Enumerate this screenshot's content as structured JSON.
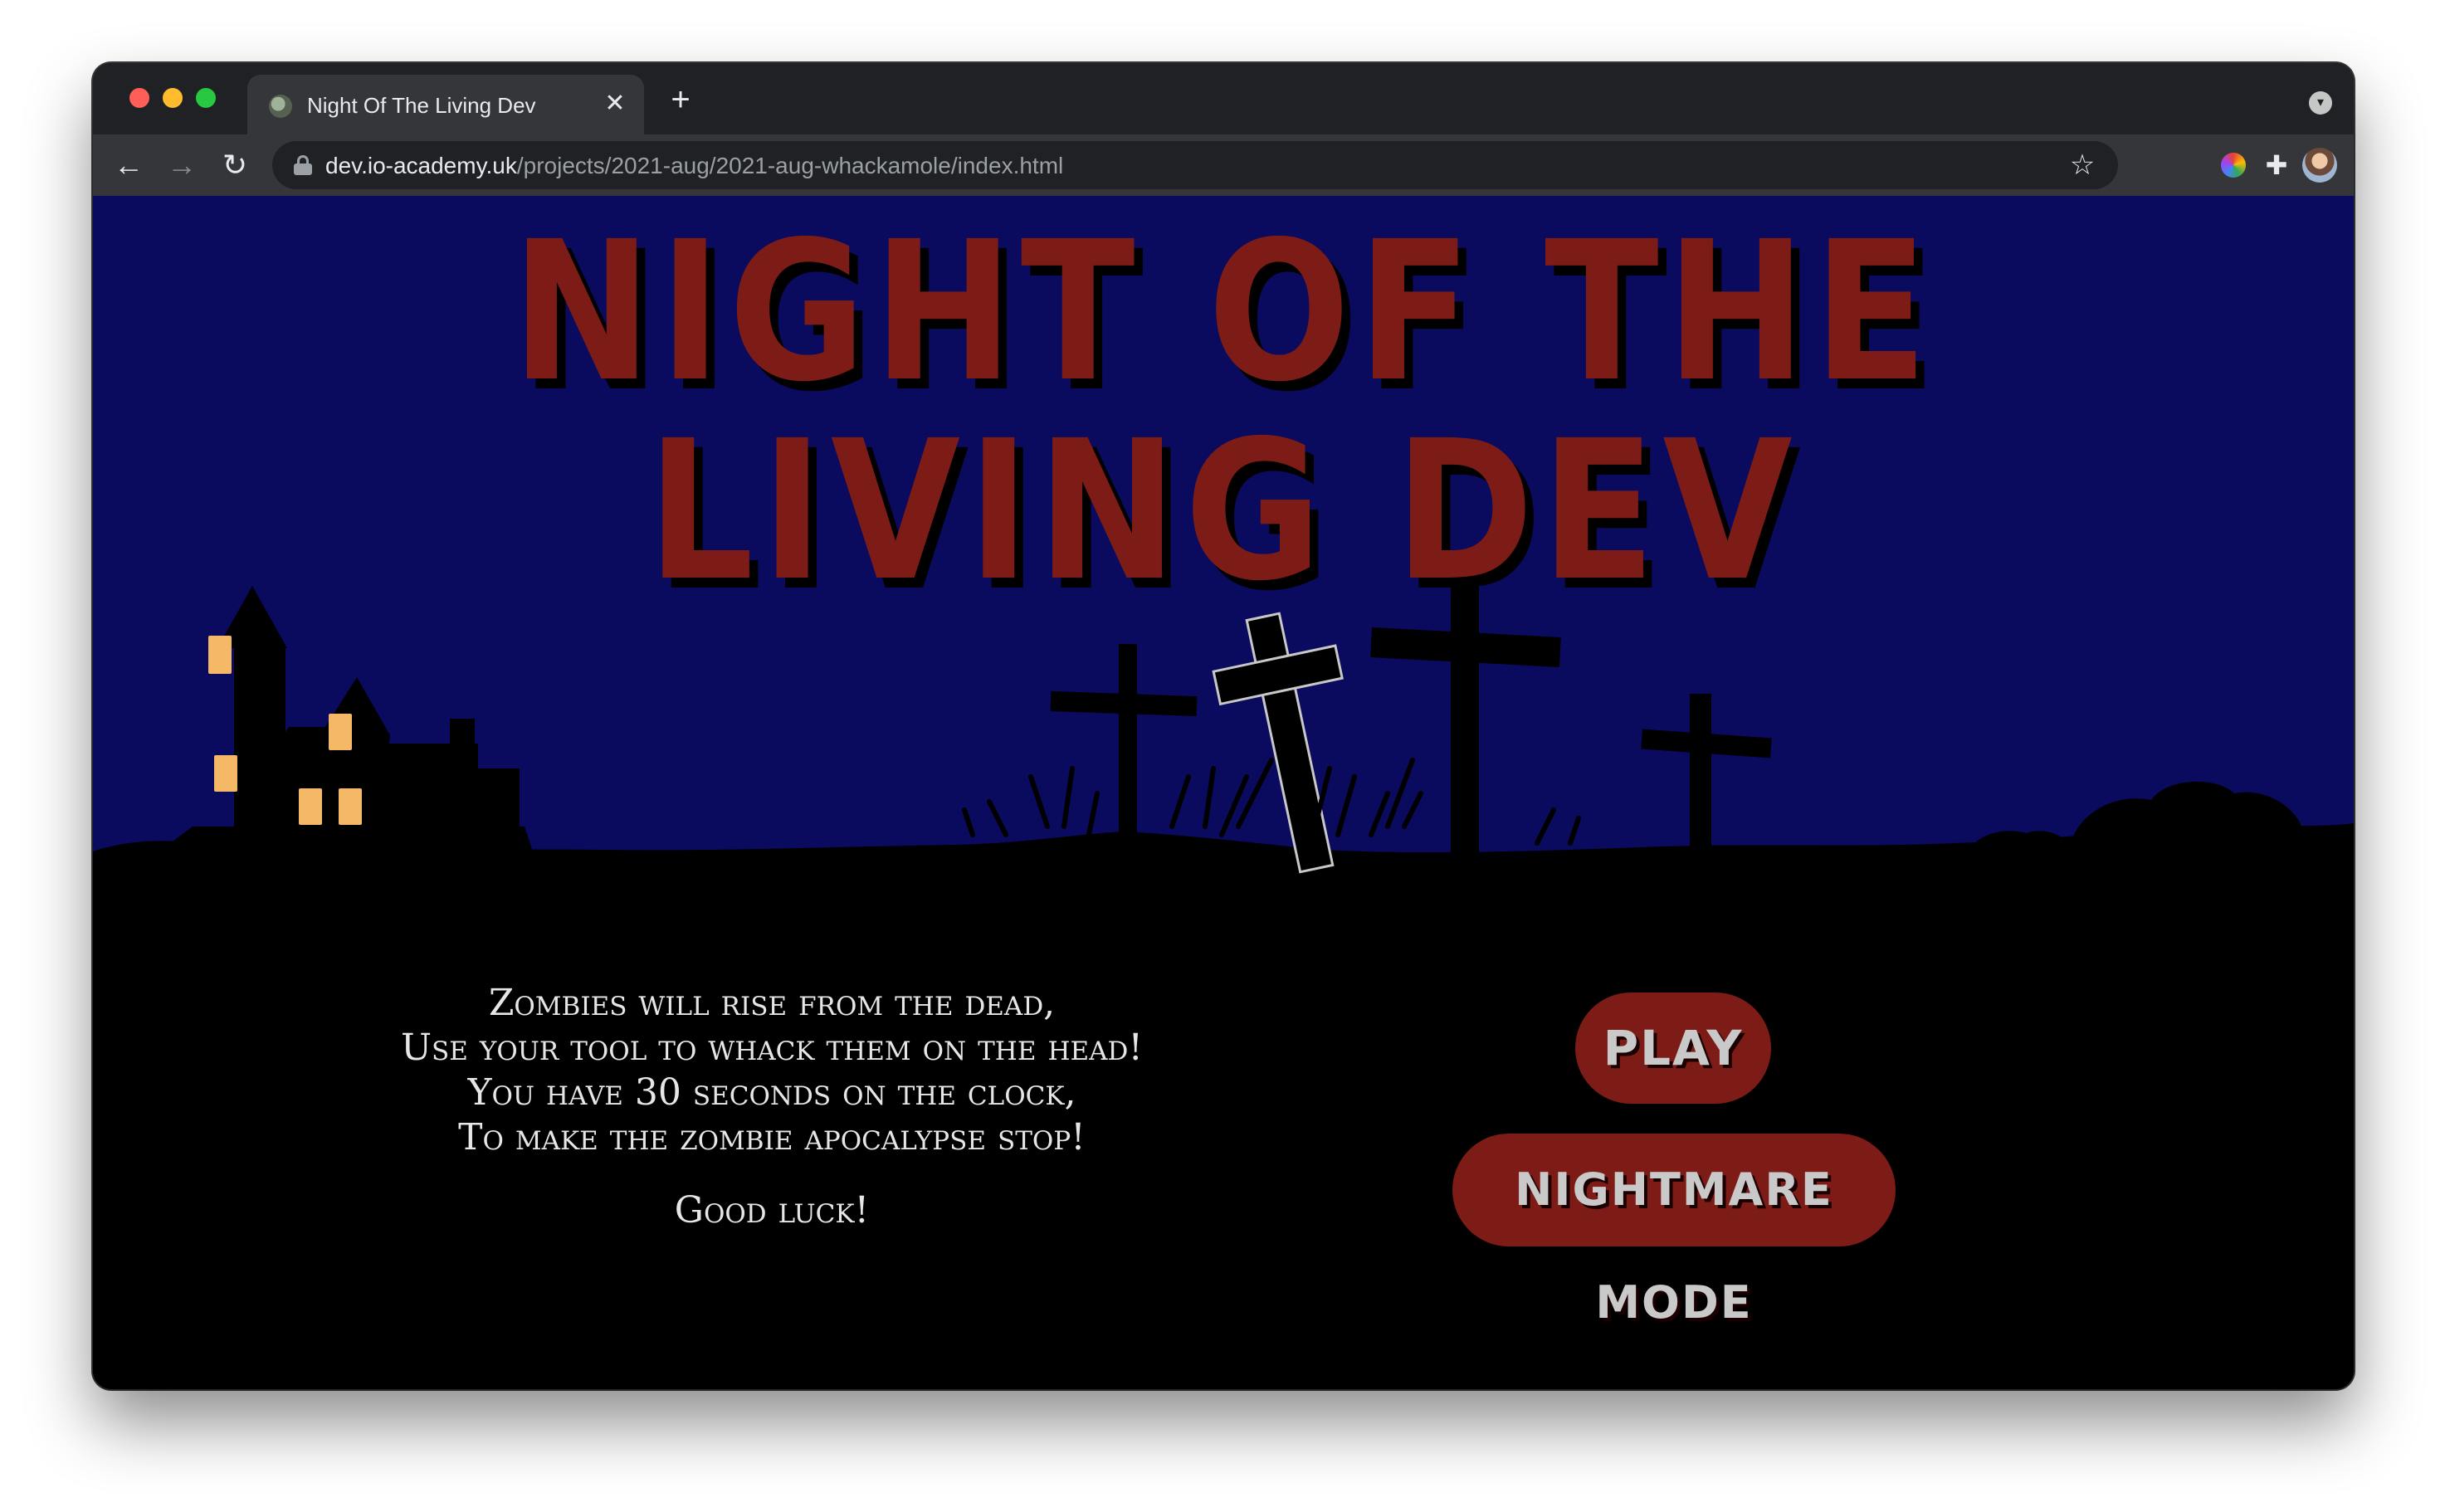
{
  "browser": {
    "tab_title": "Night Of The Living Dev",
    "url_host": "dev.io-academy.uk",
    "url_path": "/projects/2021-aug/2021-aug-whackamole/index.html",
    "tab_close_glyph": "✕",
    "new_tab_glyph": "+",
    "back_glyph": "←",
    "forward_glyph": "→",
    "reload_glyph": "↻",
    "star_glyph": "☆",
    "puzzle_glyph": "✚",
    "search_glyph": "▾"
  },
  "page": {
    "title": "NIGHT OF THE LIVING DEV",
    "intro_lines": [
      "Zombies will rise from the dead,",
      "Use your tool to whack them on the head!",
      "You have 30 seconds on the clock,",
      "To make the zombie apocalypse stop!"
    ],
    "good_luck": "Good luck!",
    "play_label": "PLAY",
    "nightmare_label": "NIGHTMARE MODE"
  },
  "colors": {
    "sky": "#0a0a5e",
    "blood_red": "#7d1c16",
    "window_light": "#f5b866",
    "ground": "#000000",
    "button_text": "#c9c9c9"
  }
}
